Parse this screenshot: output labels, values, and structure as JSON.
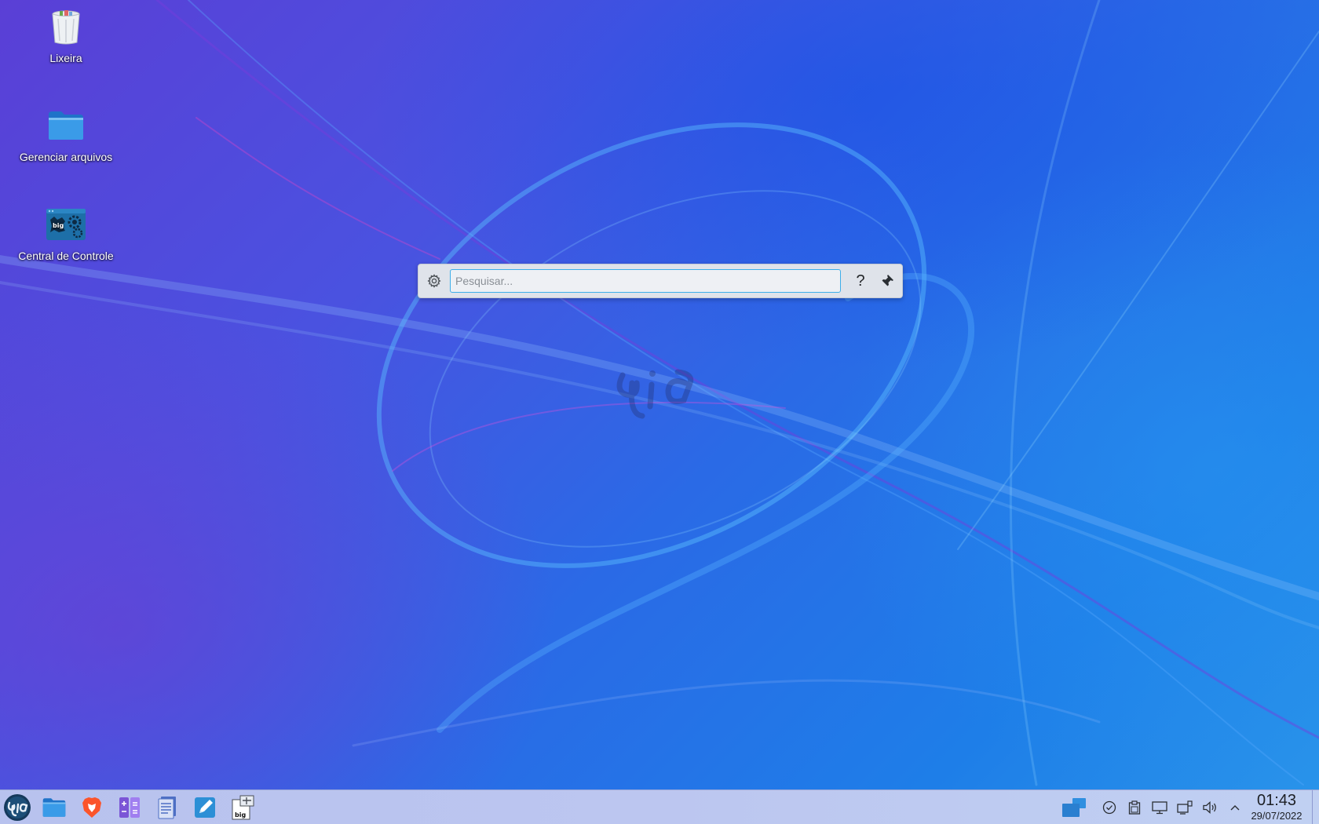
{
  "desktop": {
    "icons": [
      {
        "label": "Lixeira",
        "icon": "trash-icon"
      },
      {
        "label": "Gerenciar arquivos",
        "icon": "folder-icon"
      },
      {
        "label": "Central de Controle",
        "icon": "control-center-icon"
      }
    ],
    "wallpaper_logo": "big"
  },
  "krunner": {
    "placeholder": "Pesquisar...",
    "value": "",
    "help_label": "?",
    "settings_icon": "gear-icon",
    "pin_icon": "pin-icon"
  },
  "taskbar": {
    "launcher_icon": "biglinux-menu-icon",
    "apps": [
      {
        "name": "Arquivos",
        "icon": "folder-icon"
      },
      {
        "name": "Brave",
        "icon": "brave-browser-icon"
      },
      {
        "name": "Calculadora",
        "icon": "calculator-icon"
      },
      {
        "name": "Documento",
        "icon": "document-icon"
      },
      {
        "name": "Editor de texto",
        "icon": "text-editor-icon"
      },
      {
        "name": "Apresentação",
        "icon": "presentation-icon"
      }
    ],
    "tray": [
      {
        "name": "virtual-desktops",
        "icon": "virtual-desktops-icon"
      },
      {
        "name": "updates",
        "icon": "check-circle-icon"
      },
      {
        "name": "clipboard",
        "icon": "clipboard-icon"
      },
      {
        "name": "display",
        "icon": "display-icon"
      },
      {
        "name": "network",
        "icon": "network-icon"
      },
      {
        "name": "volume",
        "icon": "volume-icon"
      },
      {
        "name": "expand",
        "icon": "chevron-up-icon"
      }
    ],
    "clock": {
      "time": "01:43",
      "date": "29/07/2022"
    }
  },
  "colors": {
    "taskbar_bg": "#bcc6f0",
    "focus_accent": "#3daee9",
    "folder_blue": "#2f8fe0"
  }
}
